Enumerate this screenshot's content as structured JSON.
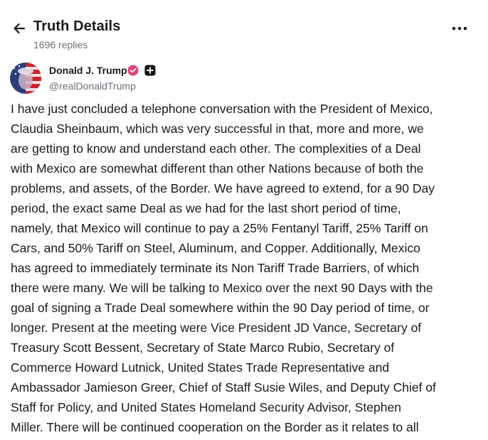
{
  "header": {
    "title": "Truth Details",
    "replies": "1696 replies"
  },
  "author": {
    "display_name": "Donald J. Trump",
    "handle": "@realDonaldTrump",
    "verified_color": "#e5407b"
  },
  "post": {
    "lines": [
      "I have just concluded a telephone conversation with the President of Mexico,",
      "Claudia Sheinbaum, which was very successful in that, more and more, we",
      "are getting to know and understand each other. The complexities of a Deal",
      "with Mexico are somewhat different than other Nations because of both the",
      "problems, and assets, of the Border. We have agreed to extend, for a 90 Day",
      "period, the exact same Deal as we had for the last short period of time,",
      "namely, that Mexico will continue to pay a 25% Fentanyl Tariff, 25% Tariff on",
      "Cars, and 50% Tariff on Steel, Aluminum, and Copper. Additionally, Mexico",
      "has agreed to immediately terminate its Non Tariff Trade Barriers, of which",
      "there were many. We will be talking to Mexico over the next 90 Days with the",
      "goal of signing a Trade Deal somewhere within the 90 Day period of time, or",
      "longer. Present at the meeting were Vice President JD Vance, Secretary of",
      "Treasury Scott Bessent, Secretary of State Marco Rubio, Secretary of",
      "Commerce Howard Lutnick, United States Trade Representative and",
      "Ambassador Jamieson Greer, Chief of Staff Susie Wiles, and Deputy Chief of",
      "Staff for Policy, and United States Homeland Security Advisor, Stephen",
      "Miller. There will be continued cooperation on the Border as it relates to all"
    ]
  }
}
